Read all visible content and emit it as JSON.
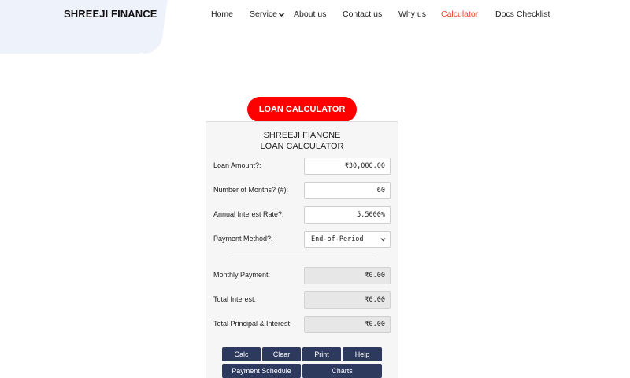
{
  "header": {
    "brand": "SHREEJI FINANCE",
    "nav": [
      {
        "label": "Home"
      },
      {
        "label": "Service"
      },
      {
        "label": "About us"
      },
      {
        "label": "Contact us"
      },
      {
        "label": "Why us"
      },
      {
        "label": "Calculator",
        "active": true
      },
      {
        "label": "Docs Checklist"
      }
    ],
    "active_color": "#e8432b"
  },
  "hero": {
    "title_button": "LOAN CALCULATOR",
    "accent": "#ff0000"
  },
  "calculator": {
    "title_line1": "SHREEJI FIANCNE",
    "title_line2": "LOAN CALCULATOR",
    "inputs": {
      "loan_amount": {
        "label": "Loan Amount?:",
        "value": "₹30,000.00"
      },
      "months": {
        "label": "Number of Months? (#):",
        "value": "60"
      },
      "rate": {
        "label": "Annual Interest Rate?:",
        "value": "5.5000%"
      },
      "method": {
        "label": "Payment Method?:",
        "value": "End-of-Period"
      }
    },
    "outputs": {
      "monthly": {
        "label": "Monthly Payment:",
        "value": "₹0.00"
      },
      "interest": {
        "label": "Total Interest:",
        "value": "₹0.00"
      },
      "total": {
        "label": "Total Principal & Interest:",
        "value": "₹0.00"
      }
    },
    "buttons": {
      "calc": "Calc",
      "clear": "Clear",
      "print": "Print",
      "help": "Help",
      "schedule": "Payment Schedule",
      "charts": "Charts"
    },
    "button_color": "#2d3a5e"
  }
}
